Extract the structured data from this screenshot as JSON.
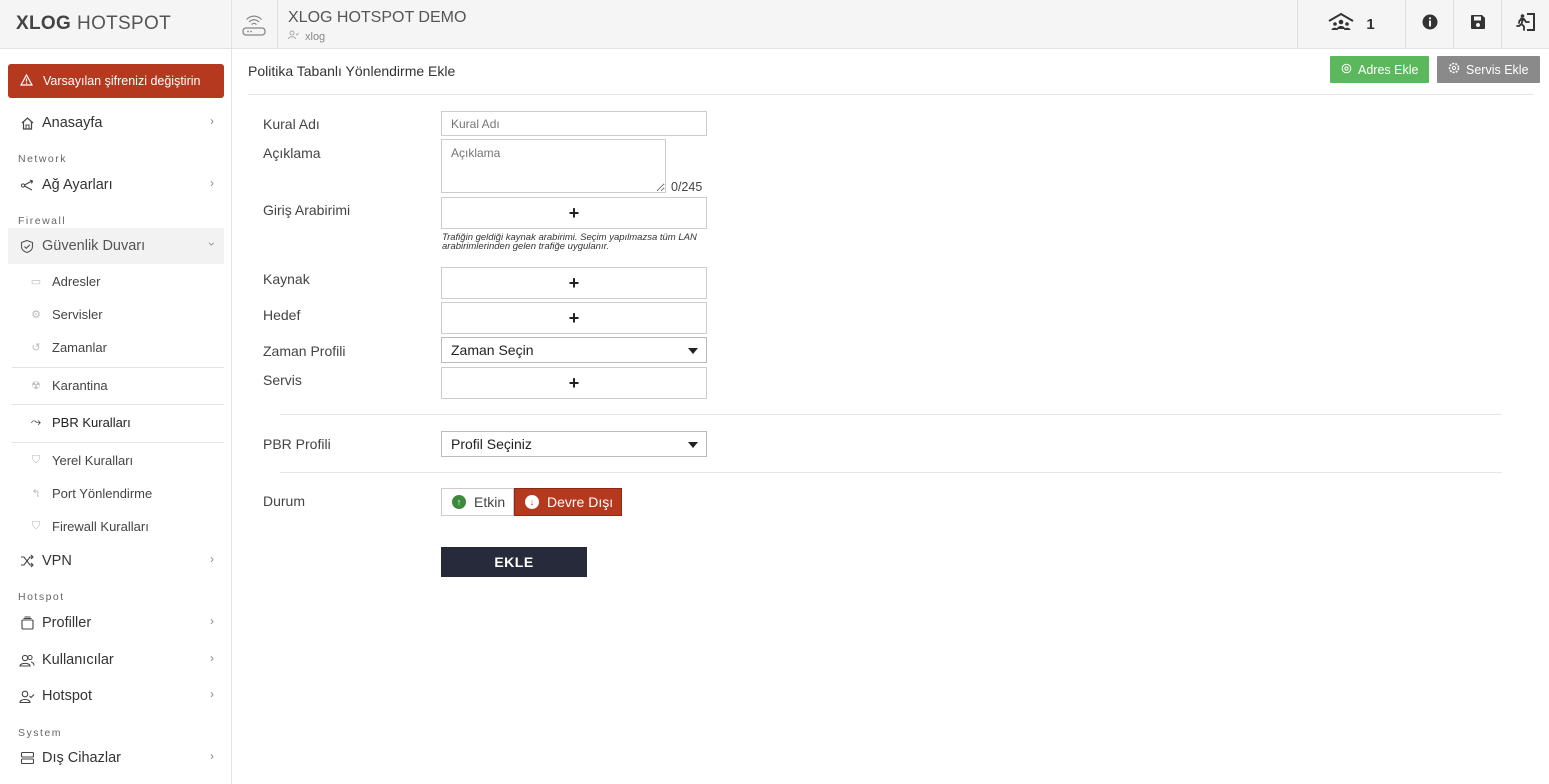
{
  "brand": {
    "bold": "XLOG",
    "rest": "HOTSPOT"
  },
  "alert": {
    "text": "Varsayılan şifrenizi değiştirin"
  },
  "sidebar": {
    "home": "Anasayfa",
    "sections": {
      "network": "Network",
      "firewall": "Firewall",
      "hotspot": "Hotspot",
      "system": "System"
    },
    "network_settings": "Ağ Ayarları",
    "firewall": "Güvenlik Duvarı",
    "firewall_sub": [
      "Adresler",
      "Servisler",
      "Zamanlar",
      "Karantina",
      "PBR Kuralları",
      "Yerel Kuralları",
      "Port Yönlendirme",
      "Firewall Kuralları"
    ],
    "vpn": "VPN",
    "profiles": "Profiller",
    "users": "Kullanıcılar",
    "hotspot": "Hotspot",
    "external_devices": "Dış Cihazlar"
  },
  "header": {
    "title": "XLOG HOTSPOT DEMO",
    "user": "xlog",
    "online_count": "1"
  },
  "main": {
    "page_title": "Politika Tabanlı Yönlendirme Ekle",
    "add_address": "Adres Ekle",
    "add_service": "Servis Ekle",
    "form": {
      "rule_name_label": "Kural Adı",
      "rule_name_placeholder": "Kural Adı",
      "description_label": "Açıklama",
      "description_placeholder": "Açıklama",
      "char_counter": "0/245",
      "input_iface_label": "Giriş Arabirimi",
      "input_iface_hint": "Trafiğin geldiği kaynak arabirimi. Seçim yapılmazsa tüm LAN arabirimlerinden gelen trafiğe uygulanır.",
      "source_label": "Kaynak",
      "destination_label": "Hedef",
      "time_profile_label": "Zaman Profili",
      "time_profile_value": "Zaman Seçin",
      "service_label": "Servis",
      "pbr_profile_label": "PBR Profili",
      "pbr_profile_value": "Profil Seçiniz",
      "status_label": "Durum",
      "status_on": "Etkin",
      "status_off": "Devre Dışı",
      "submit": "EKLE",
      "plus": "+"
    }
  },
  "colors": {
    "danger": "#b5391f",
    "success": "#5cb85c",
    "dark": "#262a3b"
  }
}
